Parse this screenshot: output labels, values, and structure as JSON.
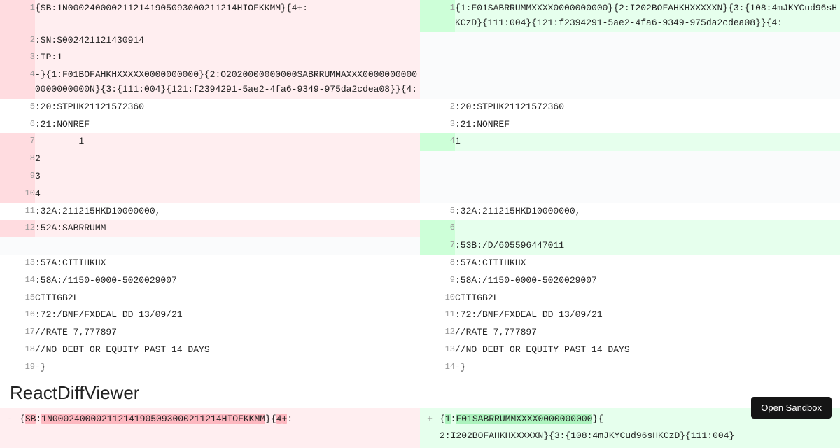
{
  "diff": {
    "rows": [
      {
        "ln": "1",
        "lc": "{SB:1N0002400002112141905093000211214HIOFKKMM}{4+:",
        "lmod": true,
        "rn": "1",
        "rc": "{1:F01SABRRUMMXXXX0000000000}{2:I202BOFAHKHXXXXXN}{3:{108:4mJKYCud96sHKCzD}{111:004}{121:f2394291-5ae2-4fa6-9349-975da2cdea08}}{4:",
        "rmod": true
      },
      {
        "ln": "2",
        "lc": ":SN:S002421121430914",
        "lmod": true,
        "rn": "",
        "rc": "",
        "rmod": false,
        "rempty": true
      },
      {
        "ln": "3",
        "lc": ":TP:1",
        "lmod": true,
        "rn": "",
        "rc": "",
        "rmod": false,
        "rempty": true
      },
      {
        "ln": "4",
        "lc": "-}{1:F01BOFAHKHXXXXX0000000000}{2:O2020000000000SABRRUMMAXXX00000000000000000000N}{3:{111:004}{121:f2394291-5ae2-4fa6-9349-975da2cdea08}}{4:",
        "lmod": true,
        "rn": "",
        "rc": "",
        "rmod": false,
        "rempty": true
      },
      {
        "ln": "5",
        "lc": ":20:STPHK21121572360",
        "lmod": false,
        "rn": "2",
        "rc": ":20:STPHK21121572360",
        "rmod": false
      },
      {
        "ln": "6",
        "lc": ":21:NONREF",
        "lmod": false,
        "rn": "3",
        "rc": ":21:NONREF",
        "rmod": false
      },
      {
        "ln": "7",
        "lc": "        1",
        "lmod": true,
        "rn": "4",
        "rc": "1",
        "rmod": true
      },
      {
        "ln": "8",
        "lc": "2",
        "lmod": true,
        "rn": "",
        "rc": "",
        "rmod": false,
        "rempty": true
      },
      {
        "ln": "9",
        "lc": "3",
        "lmod": true,
        "rn": "",
        "rc": "",
        "rmod": false,
        "rempty": true
      },
      {
        "ln": "10",
        "lc": "4",
        "lmod": true,
        "rn": "",
        "rc": "",
        "rmod": false,
        "rempty": true
      },
      {
        "ln": "11",
        "lc": ":32A:211215HKD10000000,",
        "lmod": false,
        "rn": "5",
        "rc": ":32A:211215HKD10000000,",
        "rmod": false
      },
      {
        "ln": "12",
        "lc": ":52A:SABRRUMM",
        "lmod": true,
        "rn": "6",
        "rc": "",
        "rmod": true
      },
      {
        "ln": "",
        "lc": "",
        "lmod": false,
        "lempty": true,
        "rn": "7",
        "rc": ":53B:/D/605596447011",
        "rmod": true
      },
      {
        "ln": "13",
        "lc": ":57A:CITIHKHX",
        "lmod": false,
        "rn": "8",
        "rc": ":57A:CITIHKHX",
        "rmod": false
      },
      {
        "ln": "14",
        "lc": ":58A:/1150-0000-5020029007",
        "lmod": false,
        "rn": "9",
        "rc": ":58A:/1150-0000-5020029007",
        "rmod": false
      },
      {
        "ln": "15",
        "lc": "CITIGB2L",
        "lmod": false,
        "rn": "10",
        "rc": "CITIGB2L",
        "rmod": false
      },
      {
        "ln": "16",
        "lc": ":72:/BNF/FXDEAL DD 13/09/21",
        "lmod": false,
        "rn": "11",
        "rc": ":72:/BNF/FXDEAL DD 13/09/21",
        "rmod": false
      },
      {
        "ln": "17",
        "lc": "//RATE 7,777897",
        "lmod": false,
        "rn": "12",
        "rc": "//RATE 7,777897",
        "rmod": false
      },
      {
        "ln": "18",
        "lc": "//NO DEBT OR EQUITY PAST 14 DAYS",
        "lmod": false,
        "rn": "13",
        "rc": "//NO DEBT OR EQUITY PAST 14 DAYS",
        "rmod": false
      },
      {
        "ln": "19",
        "lc": "-}",
        "lmod": false,
        "rn": "14",
        "rc": "-}",
        "rmod": false
      }
    ]
  },
  "heading": "ReactDiffViewer",
  "wordDiff": {
    "minus": "-",
    "plus": "+",
    "left": {
      "pre": "{",
      "seg1": "SB",
      "mid1": ":",
      "seg2": "1N0002400002112141905093000211214HIOFKKMM",
      "mid2": "}{",
      "seg3": "4",
      "mid3": "+",
      "post": ":"
    },
    "right": {
      "pre": "{",
      "seg1": "1",
      "mid1": ":",
      "seg2": "F01SABRRUMMXXXX0000000000",
      "post1": "}{",
      "line2": "2:I202BOFAHKHXXXXXN}{3:{108:4mJKYCud96sHKCzD}{111:004}"
    }
  },
  "sandbox": "Open Sandbox"
}
